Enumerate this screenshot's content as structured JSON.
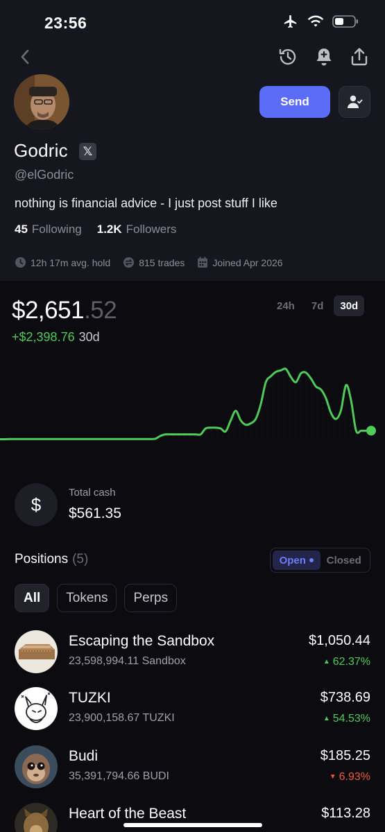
{
  "status_bar": {
    "time": "23:56"
  },
  "profile": {
    "name": "Godric",
    "x_badge": "𝕏",
    "handle": "@elGodric",
    "bio": "nothing is financial advice - I just post stuff I like",
    "following_count": "45",
    "following_label": "Following",
    "followers_count": "1.2K",
    "followers_label": "Followers",
    "avg_hold": "12h 17m avg. hold",
    "trades": "815 trades",
    "joined": "Joined Apr 2026",
    "send_label": "Send"
  },
  "balance": {
    "dollars": "$2,651",
    "cents": ".52",
    "pnl": "+$2,398.76",
    "pnl_period": "30d",
    "ranges": [
      "24h",
      "7d",
      "30d"
    ],
    "active_range": "30d"
  },
  "chart_data": {
    "type": "line",
    "title": "",
    "xlabel": "",
    "ylabel": "",
    "color": "#4fcb5a",
    "values": [
      2.4,
      2.4,
      2.6,
      2.6,
      2.6,
      2.6,
      2.6,
      2.6,
      2.6,
      2.6,
      2.6,
      2.6,
      2.6,
      2.6,
      2.6,
      2.6,
      2.6,
      2.6,
      2.6,
      2.6,
      2.6,
      2.6,
      2.6,
      2.6,
      2.6,
      2.6,
      2.6,
      2.6,
      2.6,
      2.6,
      2.6,
      3.0,
      7.0,
      9.0,
      9.0,
      9.0,
      9.0,
      9.0,
      9.0,
      9.0,
      9.0,
      17.0,
      18.0,
      18.0,
      17.0,
      13.0,
      28.0,
      41.0,
      28.0,
      22.0,
      24.0,
      30.0,
      50.0,
      80.0,
      88.0,
      94.0,
      96.0,
      98.0,
      87.0,
      80.0,
      92.0,
      93.0,
      85.0,
      74.0,
      70.0,
      58.0,
      38.0,
      30.0,
      42.0,
      76.0,
      55.0,
      14.0,
      14.0,
      14.0,
      14.0
    ],
    "ylim": [
      0,
      100
    ],
    "grid": false,
    "legend": "none"
  },
  "cash": {
    "label": "Total cash",
    "value": "$561.35",
    "symbol": "$"
  },
  "positions": {
    "title": "Positions",
    "count": "(5)",
    "toggle_open": "Open",
    "toggle_closed": "Closed",
    "filters": [
      "All",
      "Tokens",
      "Perps"
    ],
    "items": [
      {
        "name": "Escaping the Sandbox",
        "qty": "23,598,994.11 Sandbox",
        "value": "$1,050.44",
        "change": "62.37%",
        "dir": "up",
        "arrow": "▲"
      },
      {
        "name": "TUZKI",
        "qty": "23,900,158.67 TUZKI",
        "value": "$738.69",
        "change": "54.53%",
        "dir": "up",
        "arrow": "▲"
      },
      {
        "name": "Budi",
        "qty": "35,391,794.66 BUDI",
        "value": "$185.25",
        "change": "6.93%",
        "dir": "down",
        "arrow": "▼"
      },
      {
        "name": "Heart of the Beast",
        "qty": "",
        "value": "$113.28",
        "change": "",
        "dir": "up",
        "arrow": ""
      }
    ]
  },
  "colors": {
    "accent": "#5b6cf6",
    "gain": "#4fcb5a",
    "loss": "#ef5b3e"
  }
}
